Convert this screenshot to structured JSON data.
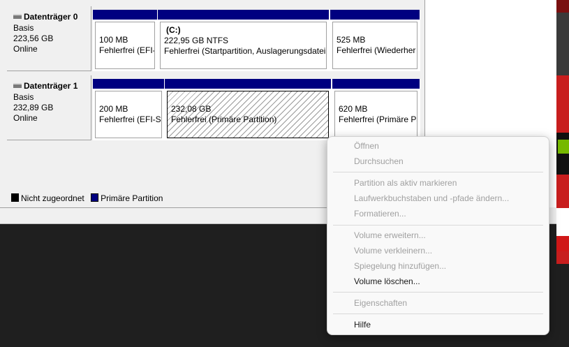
{
  "disks": [
    {
      "name": "Datenträger 0",
      "type": "Basis",
      "size": "223,56 GB",
      "status": "Online",
      "partitions": [
        {
          "title": "",
          "size": "100 MB",
          "status": "Fehlerfrei (EFI-"
        },
        {
          "title": "(C:)",
          "size": "222,95 GB NTFS",
          "status": "Fehlerfrei (Startpartition, Auslagerungsdatei,"
        },
        {
          "title": "",
          "size": "525 MB",
          "status": "Fehlerfrei (Wiederher"
        }
      ]
    },
    {
      "name": "Datenträger 1",
      "type": "Basis",
      "size": "232,89 GB",
      "status": "Online",
      "partitions": [
        {
          "title": "",
          "size": "200 MB",
          "status": "Fehlerfrei (EFI-Sy"
        },
        {
          "title": "",
          "size": "232,08 GB",
          "status": "Fehlerfrei (Primäre Partition)",
          "selected": true
        },
        {
          "title": "",
          "size": "620 MB",
          "status": "Fehlerfrei (Primäre Pa"
        }
      ]
    }
  ],
  "legend": {
    "unallocated": "Nicht zugeordnet",
    "primary": "Primäre Partition",
    "unallocated_color": "#000000",
    "primary_color": "#000080"
  },
  "context_menu": {
    "items": [
      {
        "label": "Öffnen",
        "enabled": false
      },
      {
        "label": "Durchsuchen",
        "enabled": false
      },
      {
        "label": "Partition als aktiv markieren",
        "enabled": false
      },
      {
        "label": "Laufwerkbuchstaben und -pfade ändern...",
        "enabled": false
      },
      {
        "label": "Formatieren...",
        "enabled": false
      },
      {
        "label": "Volume erweitern...",
        "enabled": false
      },
      {
        "label": "Volume verkleinern...",
        "enabled": false
      },
      {
        "label": "Spiegelung hinzufügen...",
        "enabled": false
      },
      {
        "label": "Volume löschen...",
        "enabled": true
      },
      {
        "label": "Eigenschaften",
        "enabled": false
      },
      {
        "label": "Hilfe",
        "enabled": true
      }
    ]
  }
}
